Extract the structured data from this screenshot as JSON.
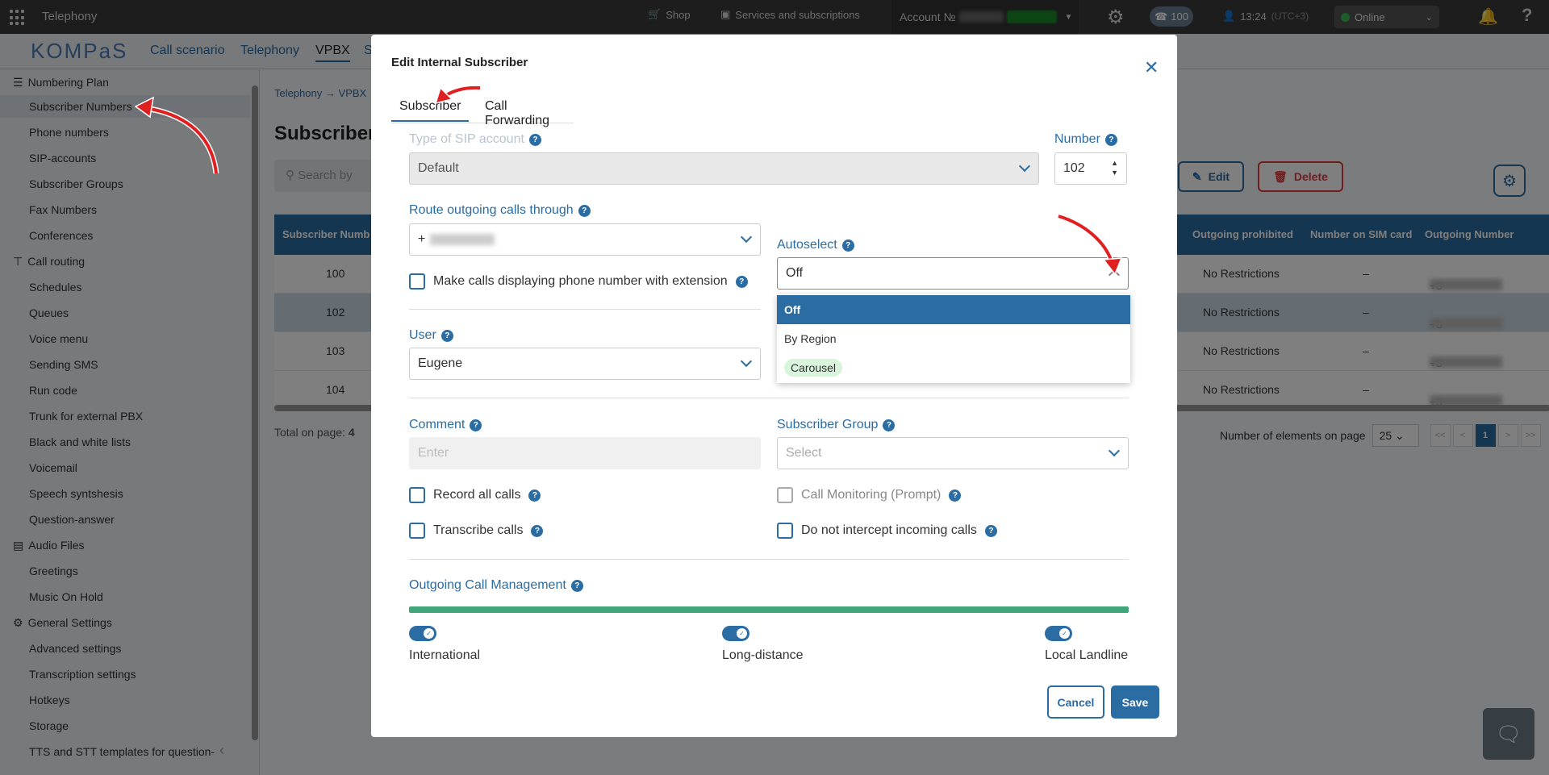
{
  "topbar": {
    "app_title": "Telephony",
    "shop": "Shop",
    "services": "Services and subscriptions",
    "account_label": "Account №",
    "extension": "100",
    "time": "13:24",
    "timezone": "(UTC+3)",
    "status": "Online",
    "icons": [
      "apps-grid-icon",
      "cart-icon",
      "services-icon",
      "gear-icon",
      "phone-icon",
      "user-icon",
      "bell-icon",
      "help-icon"
    ]
  },
  "nav": {
    "logo": "KOMPaS",
    "items": [
      "Call scenario",
      "Telephony",
      "VPBX",
      "S"
    ],
    "active": "VPBX"
  },
  "sidebar": {
    "groups": [
      {
        "label": "Numbering Plan",
        "icon": "list-icon",
        "items": [
          "Subscriber Numbers",
          "Phone numbers",
          "SIP-accounts",
          "Subscriber Groups",
          "Fax Numbers",
          "Conferences"
        ]
      },
      {
        "label": "Call routing",
        "icon": "routing-icon",
        "items": [
          "Schedules",
          "Queues",
          "Voice menu",
          "Sending SMS",
          "Run code",
          "Trunk for external PBX",
          "Black and white lists",
          "Voicemail",
          "Speech syntshesis",
          "Question-answer"
        ]
      },
      {
        "label": "Audio Files",
        "icon": "audio-icon",
        "items": [
          "Greetings",
          "Music On Hold"
        ]
      },
      {
        "label": "General Settings",
        "icon": "settings-icon",
        "items": [
          "Advanced settings",
          "Transcription settings",
          "Hotkeys",
          "Storage",
          "TTS and STT templates for question-"
        ]
      }
    ],
    "active_item": "Subscriber Numbers"
  },
  "page": {
    "breadcrumb": [
      "Telephony",
      "VPBX"
    ],
    "title": "Subscriber",
    "search_placeholder": "Search by",
    "edit_label": "Edit",
    "delete_label": "Delete",
    "columns": [
      "Subscriber Numb",
      "Outgoing prohibited",
      "Number on SIM card",
      "Outgoing Number"
    ],
    "rows": [
      {
        "number": "100",
        "prohibited": "No Restrictions",
        "sim": "–",
        "outgoing": "+3"
      },
      {
        "number": "102",
        "prohibited": "No Restrictions",
        "sim": "–",
        "outgoing": "+3"
      },
      {
        "number": "103",
        "prohibited": "No Restrictions",
        "sim": "–",
        "outgoing": "+3"
      },
      {
        "number": "104",
        "prohibited": "No Restrictions",
        "sim": "–",
        "outgoing": "+3"
      }
    ],
    "selected_row": "102",
    "total_label": "Total on page:",
    "total_value": "4",
    "per_page_label": "Number of elements on page",
    "per_page_value": "25",
    "pager": [
      "<<",
      "<",
      "1",
      ">",
      ">>"
    ],
    "current_page": "1"
  },
  "modal": {
    "title": "Edit Internal Subscriber",
    "tabs": [
      "Subscriber",
      "Call Forwarding"
    ],
    "active_tab": "Subscriber",
    "sip_type_label": "Type of SIP account",
    "sip_type_value": "Default",
    "number_label": "Number",
    "number_value": "102",
    "route_label": "Route outgoing calls through",
    "route_value": "+",
    "autoselect_label": "Autoselect",
    "autoselect_value": "Off",
    "autoselect_options": [
      "Off",
      "By Region",
      "Carousel"
    ],
    "autoselect_selected": "Off",
    "extension_display_label": "Make calls displaying phone number with extension",
    "user_label": "User",
    "user_value": "Eugene",
    "comment_label": "Comment",
    "comment_placeholder": "Enter",
    "group_label": "Subscriber Group",
    "group_placeholder": "Select",
    "record_label": "Record all calls",
    "monitoring_label": "Call Monitoring (Prompt)",
    "transcribe_label": "Transcribe calls",
    "no_intercept_label": "Do not intercept incoming calls",
    "outgoing_mgmt_label": "Outgoing Call Management",
    "outgoing_mgmt_level": 1.0,
    "toggles": [
      "International",
      "Long-distance",
      "Local Landline"
    ],
    "cancel_label": "Cancel",
    "save_label": "Save"
  },
  "colors": {
    "primary": "#2b6ca3",
    "danger": "#e23c3c",
    "success": "#3fa679",
    "annotation_arrow": "#e02020"
  }
}
